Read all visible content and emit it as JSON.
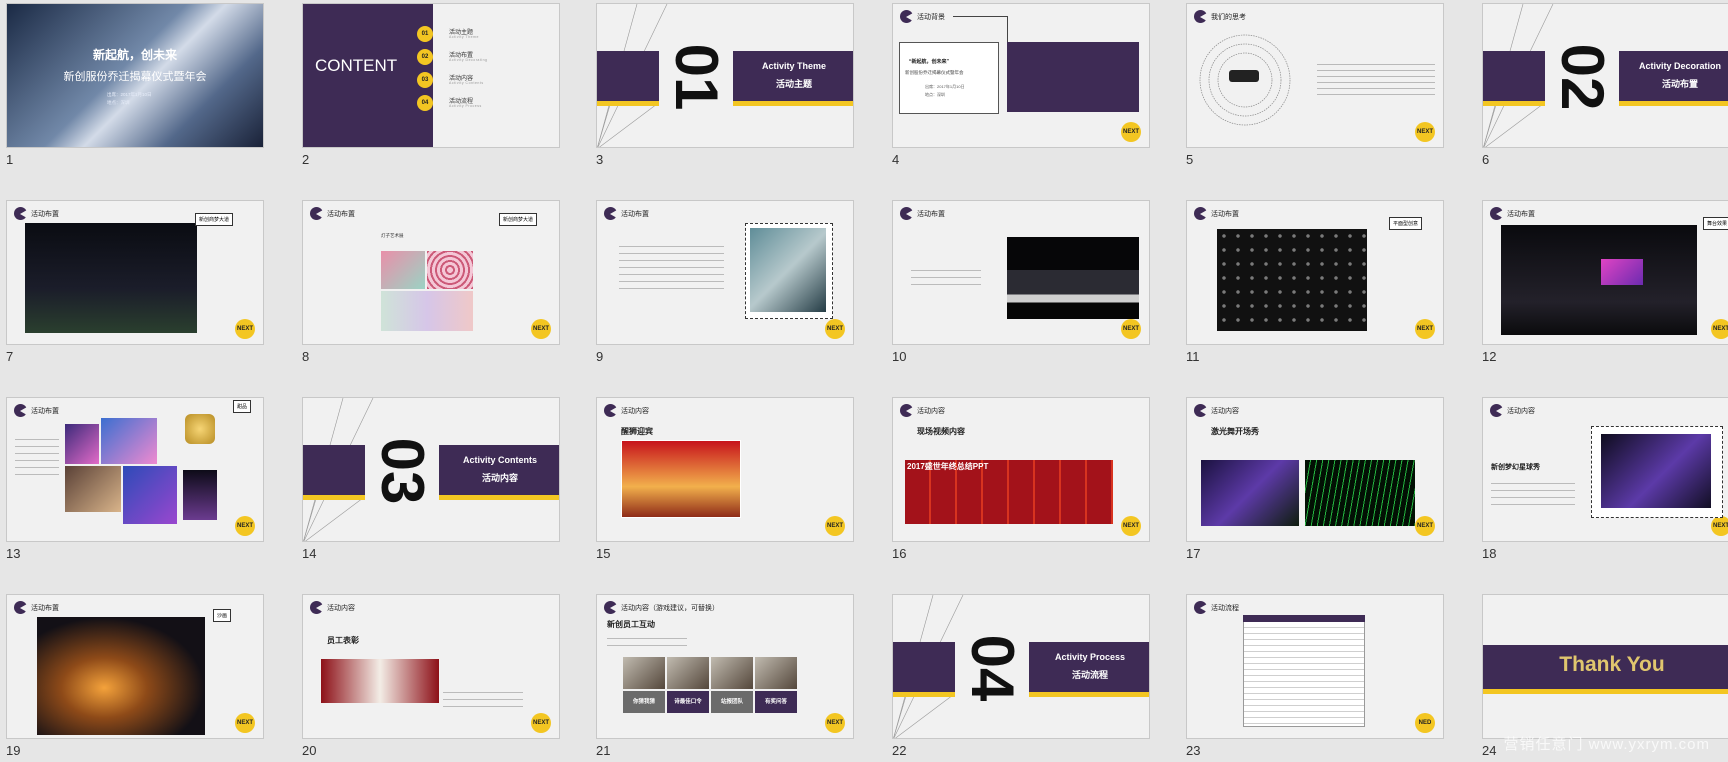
{
  "slides": [
    {
      "n": "1",
      "title": "新起航，创未来",
      "subtitle": "新创服份乔迁揭幕仪式暨年会",
      "meta1": "出席：2017年1月10日",
      "meta2": "地点：深圳"
    },
    {
      "n": "2",
      "content_title": "CONTENT",
      "items": [
        {
          "no": "01",
          "cn": "活动主题",
          "en": "Activity Theme"
        },
        {
          "no": "02",
          "cn": "活动布置",
          "en": "Activity Decorating"
        },
        {
          "no": "03",
          "cn": "活动内容",
          "en": "Activity Contents"
        },
        {
          "no": "04",
          "cn": "活动流程",
          "en": "Activity Process"
        }
      ]
    },
    {
      "n": "3",
      "big": "01",
      "en": "Activity Theme",
      "cn": "活动主题"
    },
    {
      "n": "4",
      "hdr": "活动背景",
      "quote": "“新起航，创未来”",
      "sub": "新创股份乔迁揭幕仪式暨年会",
      "date": "出席：2017年1月10日",
      "place": "地点：深圳",
      "next": "NEXT"
    },
    {
      "n": "5",
      "hdr": "我们的思考",
      "next": "NEXT"
    },
    {
      "n": "6",
      "big": "02",
      "en": "Activity Decoration",
      "cn": "活动布置"
    },
    {
      "n": "7",
      "hdr": "活动布置",
      "tag": "新创商梦大道",
      "next": "NEXT"
    },
    {
      "n": "8",
      "hdr": "活动布置",
      "tag": "新创商梦大道",
      "note": "灯子艺术展",
      "next": "NEXT"
    },
    {
      "n": "9",
      "hdr": "活动布置",
      "next": "NEXT"
    },
    {
      "n": "10",
      "hdr": "活动布置",
      "next": "NEXT"
    },
    {
      "n": "11",
      "hdr": "活动布置",
      "tag": "平面型创意",
      "next": "NEXT"
    },
    {
      "n": "12",
      "hdr": "活动布置",
      "tag": "舞台效果",
      "next": "NEXT"
    },
    {
      "n": "13",
      "hdr": "活动布置",
      "tag": "甜品",
      "next": "NEXT"
    },
    {
      "n": "14",
      "big": "03",
      "en": "Activity Contents",
      "cn": "活动内容"
    },
    {
      "n": "15",
      "hdr": "活动内容",
      "title": "醒狮迎宾",
      "next": "NEXT"
    },
    {
      "n": "16",
      "hdr": "活动内容",
      "title": "现场视频内容",
      "ppt": "2017盛世年终总结PPT",
      "next": "NEXT"
    },
    {
      "n": "17",
      "hdr": "活动内容",
      "title": "激光舞开场秀",
      "next": "NEXT"
    },
    {
      "n": "18",
      "hdr": "活动内容",
      "title": "新创梦幻星球秀",
      "next": "NEXT"
    },
    {
      "n": "19",
      "hdr": "活动布置",
      "tag": "沙画",
      "next": "NEXT"
    },
    {
      "n": "20",
      "hdr": "活动内容",
      "title": "员工表彰",
      "next": "NEXT"
    },
    {
      "n": "21",
      "hdr": "活动内容（游戏建议，可替换）",
      "title": "新创员工互动",
      "labels": [
        "你猜我猜",
        "诗最佳口令",
        "站报团队",
        "有奖问答"
      ],
      "next": "NEXT"
    },
    {
      "n": "22",
      "big": "04",
      "en": "Activity Process",
      "cn": "活动流程"
    },
    {
      "n": "23",
      "hdr": "活动流程",
      "next": "NED"
    },
    {
      "n": "24",
      "thanks": "Thank You"
    }
  ],
  "watermark": "营销任意门 www.yxrym.com",
  "colors": {
    "purple": "#3e2b55",
    "yellow": "#f3c622"
  }
}
